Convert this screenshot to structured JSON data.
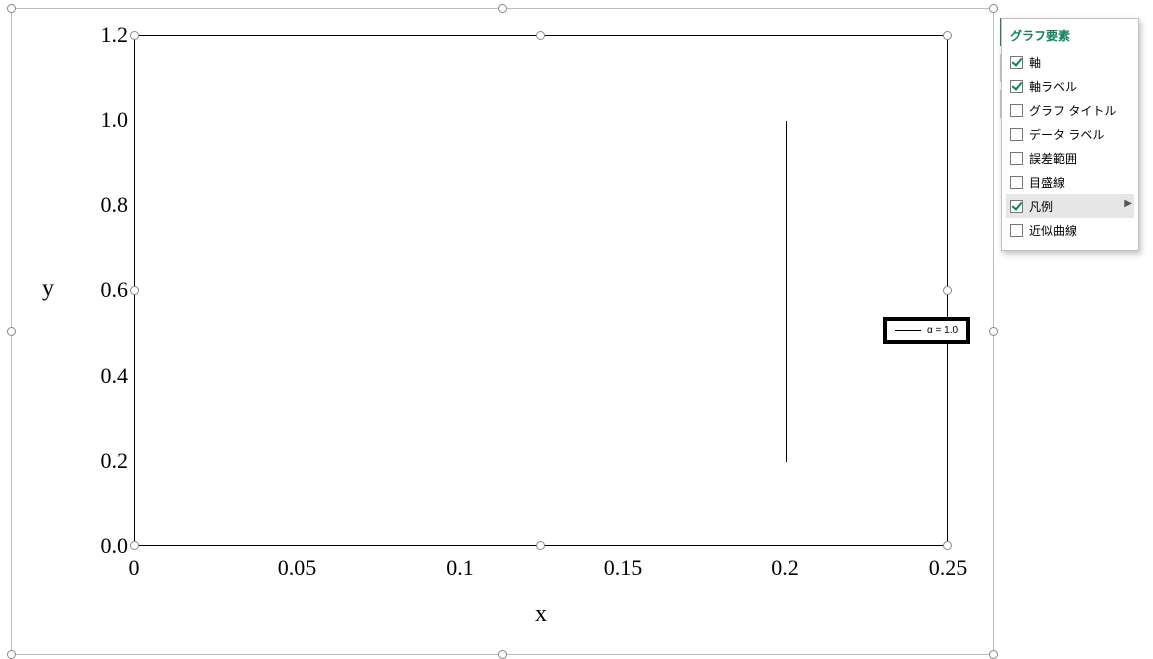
{
  "chart_data": {
    "type": "line",
    "xlabel": "x",
    "ylabel": "y",
    "xlim": [
      0,
      0.25
    ],
    "ylim": [
      0,
      1.2
    ],
    "x_ticks": [
      0,
      0.05,
      0.1,
      0.15,
      0.2,
      0.25
    ],
    "y_ticks": [
      0.0,
      0.2,
      0.4,
      0.6,
      0.8,
      1.0,
      1.2
    ],
    "series": [
      {
        "name": "α = 1.0",
        "x": [
          0.2,
          0.2
        ],
        "y": [
          0.2,
          1.0
        ]
      }
    ],
    "legend_position": "right"
  },
  "axis": {
    "x": "x",
    "y": "y"
  },
  "ticks": {
    "x": [
      "0",
      "0.05",
      "0.1",
      "0.15",
      "0.2",
      "0.25"
    ],
    "y": [
      "0.0",
      "0.2",
      "0.4",
      "0.6",
      "0.8",
      "1.0",
      "1.2"
    ]
  },
  "legend": {
    "items": [
      {
        "label": "α = 1.0"
      }
    ]
  },
  "side_buttons": {
    "plus": {
      "name": "chart-elements-button",
      "active": true
    },
    "brush": {
      "name": "chart-styles-button",
      "active": false
    },
    "filter": {
      "name": "chart-filters-button",
      "active": false
    }
  },
  "flyout": {
    "title": "グラフ要素",
    "items": [
      {
        "label": "軸",
        "checked": true,
        "hovered": false,
        "expand": false
      },
      {
        "label": "軸ラベル",
        "checked": true,
        "hovered": false,
        "expand": false
      },
      {
        "label": "グラフ タイトル",
        "checked": false,
        "hovered": false,
        "expand": false
      },
      {
        "label": "データ ラベル",
        "checked": false,
        "hovered": false,
        "expand": false
      },
      {
        "label": "誤差範囲",
        "checked": false,
        "hovered": false,
        "expand": false
      },
      {
        "label": "目盛線",
        "checked": false,
        "hovered": false,
        "expand": false
      },
      {
        "label": "凡例",
        "checked": true,
        "hovered": true,
        "expand": true
      },
      {
        "label": "近似曲線",
        "checked": false,
        "hovered": false,
        "expand": false
      }
    ]
  }
}
